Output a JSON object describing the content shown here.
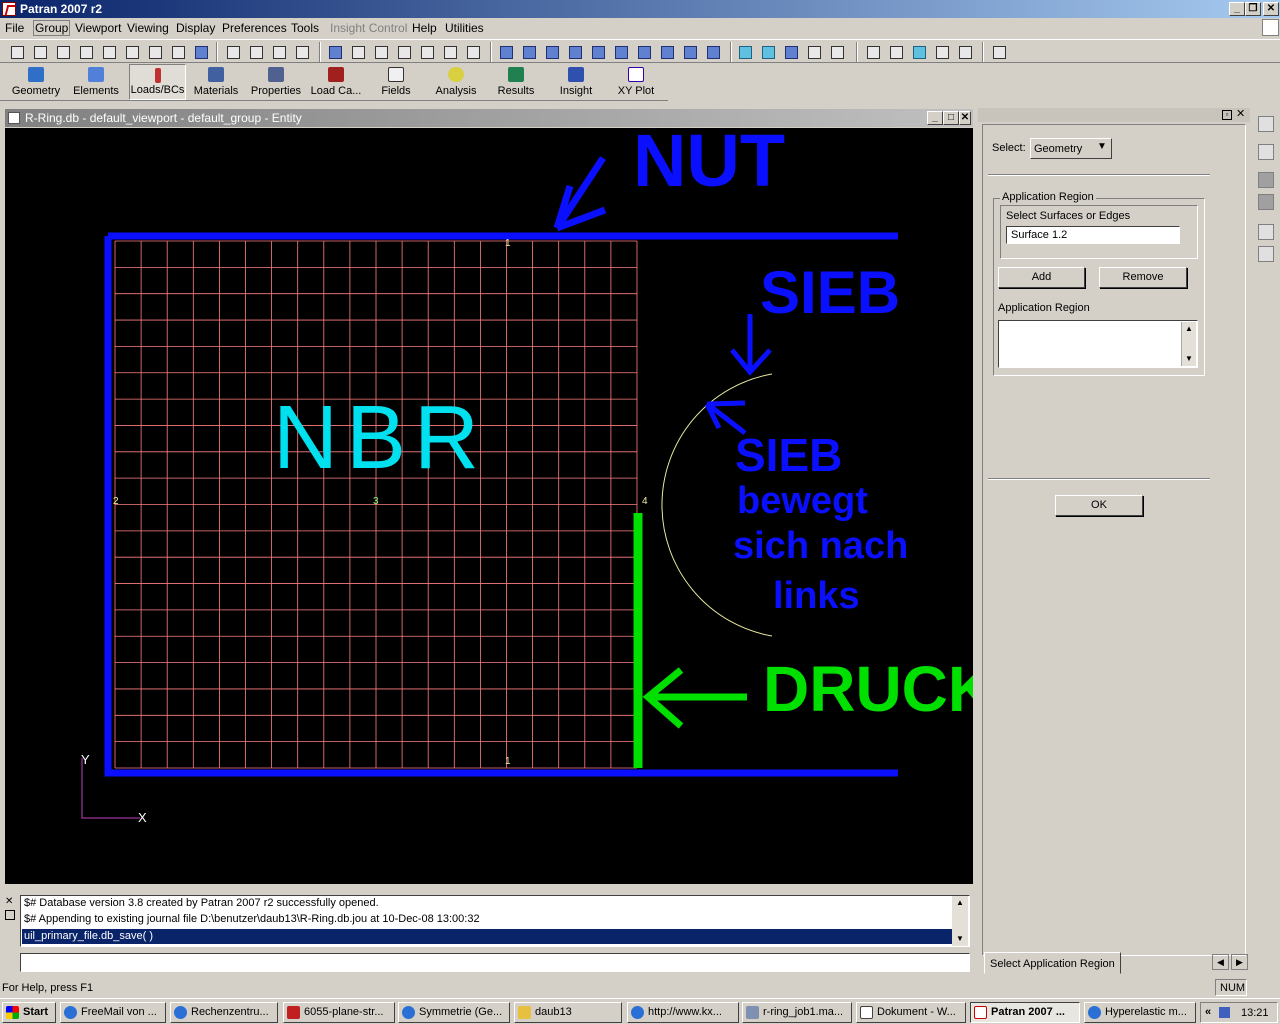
{
  "window": {
    "title": "Patran 2007 r2"
  },
  "menubar": {
    "items": [
      "File",
      "Group",
      "Viewport",
      "Viewing",
      "Display",
      "Preferences",
      "Tools",
      "Insight Control",
      "Help",
      "Utilities"
    ]
  },
  "applications": [
    "Geometry",
    "Elements",
    "Loads/BCs",
    "Materials",
    "Properties",
    "Load Ca...",
    "Fields",
    "Analysis",
    "Results",
    "Insight",
    "XY Plot"
  ],
  "viewport": {
    "title": "R-Ring.db - default_viewport - default_group - Entity",
    "annotations": {
      "nut": "NUT",
      "sieb_top": "SIEB",
      "nbr": "NBR",
      "sieb_label": "SIEB",
      "sieb_line1": "bewegt",
      "sieb_line2": "sich nach",
      "sieb_line3": "links",
      "druck": "DRUCK"
    },
    "markers": {
      "m1": "1",
      "m2": "2",
      "m3": "3",
      "m4": "4",
      "m5": "1",
      "axis_y": "Y",
      "axis_x": "X"
    },
    "colors": {
      "blue": "#0a10ff",
      "cyan": "#00e0ee",
      "green": "#00e000",
      "mesh": "#ff8080",
      "arc": "#e8e8a0"
    }
  },
  "panel": {
    "select_label": "Select:",
    "select_value": "Geometry",
    "app_region_group": "Application Region",
    "select_surfaces_label": "Select Surfaces or Edges",
    "surface_value": "Surface 1.2",
    "add": "Add",
    "remove": "Remove",
    "app_region_label": "Application Region",
    "ok": "OK",
    "footer_tab": "Select Application Region"
  },
  "console": {
    "lines": [
      "$# Database version 3.8 created by Patran 2007 r2 successfully opened.",
      "$# Appending to existing journal file D:\\benutzer\\daub13\\R-Ring.db.jou at 10-Dec-08 13:00:32",
      "uil_primary_file.db_save( )"
    ]
  },
  "status": {
    "help": "For Help, press F1",
    "num": "NUM"
  },
  "taskbar": {
    "start": "Start",
    "tasks": [
      "FreeMail von ...",
      "Rechenzentru...",
      "6055-plane-str...",
      "Symmetrie (Ge...",
      "daub13",
      "http://www.kx...",
      "r-ring_job1.ma...",
      "Dokument - W...",
      "Patran 2007 ...",
      "Hyperelastic m..."
    ],
    "chevron": "«",
    "clock": "13:21"
  }
}
